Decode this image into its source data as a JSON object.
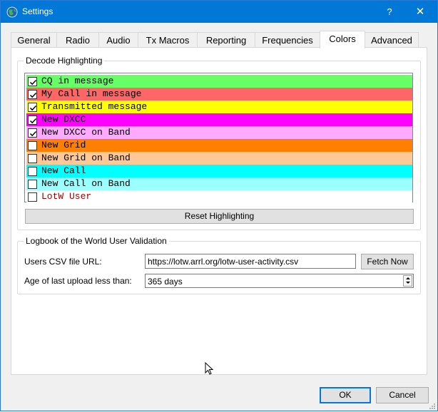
{
  "window": {
    "title": "Settings",
    "help_label": "?",
    "close_label": "✕",
    "app_icon": "wsjt-globe-icon"
  },
  "tabs": [
    {
      "label": "General",
      "active": false
    },
    {
      "label": "Radio",
      "active": false
    },
    {
      "label": "Audio",
      "active": false
    },
    {
      "label": "Tx Macros",
      "active": false
    },
    {
      "label": "Reporting",
      "active": false
    },
    {
      "label": "Frequencies",
      "active": false
    },
    {
      "label": "Colors",
      "active": true
    },
    {
      "label": "Advanced",
      "active": false
    }
  ],
  "decode_highlighting": {
    "title": "Decode Highlighting",
    "items": [
      {
        "label": "CQ in message",
        "checked": true,
        "bg": "#66ff66",
        "fg": "#000000"
      },
      {
        "label": "My Call in message",
        "checked": true,
        "bg": "#ff6666",
        "fg": "#000000"
      },
      {
        "label": "Transmitted message",
        "checked": true,
        "bg": "#ffff00",
        "fg": "#000000"
      },
      {
        "label": "New DXCC",
        "checked": true,
        "bg": "#ff00ff",
        "fg": "#000000"
      },
      {
        "label": "New DXCC on Band",
        "checked": true,
        "bg": "#ffaaff",
        "fg": "#000000"
      },
      {
        "label": "New Grid",
        "checked": false,
        "bg": "#ff8000",
        "fg": "#000000"
      },
      {
        "label": "New Grid on Band",
        "checked": false,
        "bg": "#ffc896",
        "fg": "#000000"
      },
      {
        "label": "New Call",
        "checked": false,
        "bg": "#00ffff",
        "fg": "#000000"
      },
      {
        "label": "New Call on Band",
        "checked": false,
        "bg": "#9cffff",
        "fg": "#000000"
      },
      {
        "label": "LotW User",
        "checked": false,
        "bg": "#ffffff",
        "fg": "#990000"
      }
    ],
    "reset_label": "Reset Highlighting"
  },
  "lotw": {
    "title": "Logbook of the World User Validation",
    "csv_label": "Users CSV file URL:",
    "csv_value": "https://lotw.arrl.org/lotw-user-activity.csv",
    "fetch_label": "Fetch Now",
    "age_label": "Age of last upload less than:",
    "age_value": "365 days"
  },
  "footer": {
    "ok_label": "OK",
    "cancel_label": "Cancel"
  }
}
